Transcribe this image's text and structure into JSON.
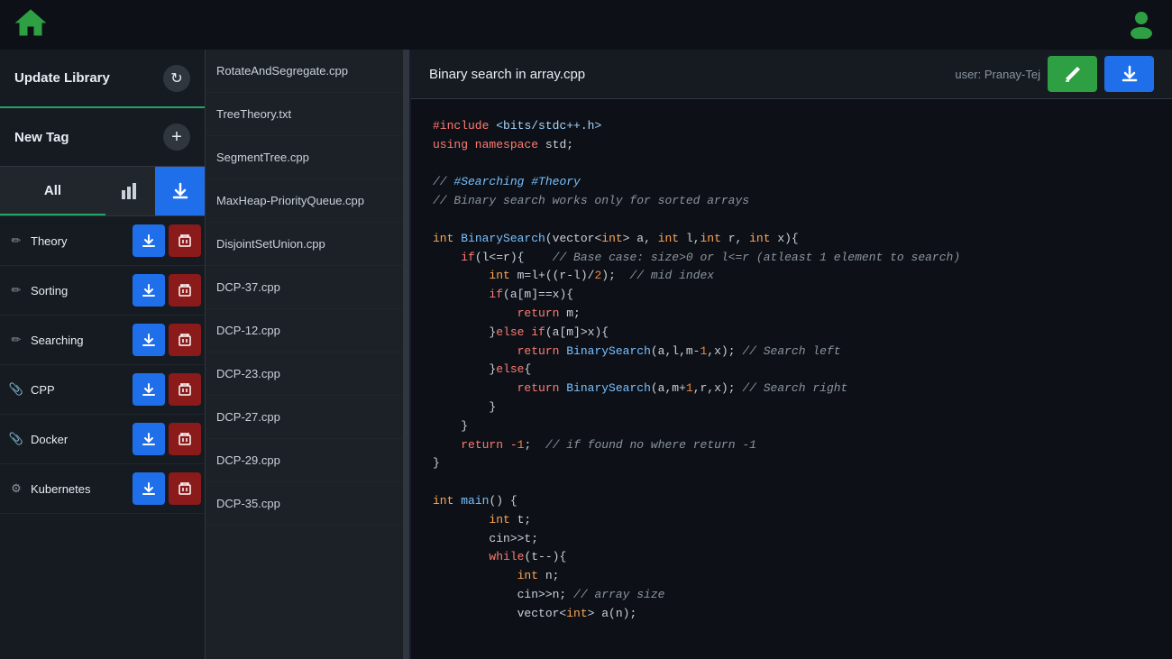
{
  "topbar": {
    "home_icon": "🏠",
    "user_icon": "👤"
  },
  "sidebar": {
    "update_library_label": "Update Library",
    "new_tag_label": "New Tag",
    "filter": {
      "all_label": "All",
      "chart_icon": "📊",
      "download_icon": "⬇"
    },
    "tags": [
      {
        "id": "theory",
        "icon": "✏",
        "label": "Theory"
      },
      {
        "id": "sorting",
        "icon": "✏",
        "label": "Sorting"
      },
      {
        "id": "searching",
        "icon": "✏",
        "label": "Searching"
      },
      {
        "id": "cpp",
        "icon": "📎",
        "label": "CPP"
      },
      {
        "id": "docker",
        "icon": "📎",
        "label": "Docker"
      },
      {
        "id": "kubernetes",
        "icon": "⚙",
        "label": "Kubernetes"
      }
    ]
  },
  "files": {
    "items": [
      "RotateAndSegregate.cpp",
      "TreeTheory.txt",
      "SegmentTree.cpp",
      "MaxHeap-PriorityQueue.cpp",
      "DisjointSetUnion.cpp",
      "DCP-37.cpp",
      "DCP-12.cpp",
      "DCP-23.cpp",
      "DCP-27.cpp",
      "DCP-29.cpp",
      "DCP-35.cpp"
    ]
  },
  "code_viewer": {
    "title": "Binary search in array.cpp",
    "user_label": "user: Pranay-Tej",
    "edit_icon": "✏",
    "download_icon": "⬇"
  }
}
